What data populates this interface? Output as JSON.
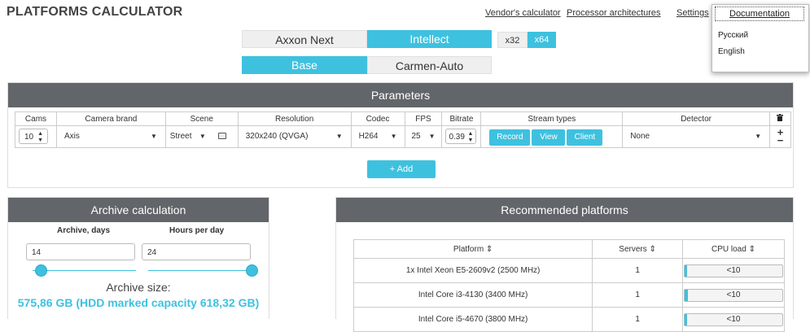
{
  "app": {
    "title": "PLATFORMS CALCULATOR"
  },
  "nav": {
    "vendors": "Vendor's calculator",
    "processors": "Processor architectures",
    "settings": "Settings",
    "documentation": "Documentation"
  },
  "language_menu": {
    "options": [
      "Русский",
      "English"
    ]
  },
  "product_toggle": {
    "options": [
      "Axxon Next",
      "Intellect"
    ],
    "selected": "Intellect"
  },
  "arch_toggle": {
    "options": [
      "x32",
      "x64"
    ],
    "selected": "x64"
  },
  "edition_toggle": {
    "options": [
      "Base",
      "Carmen-Auto"
    ],
    "selected": "Base"
  },
  "parameters": {
    "title": "Parameters",
    "columns": [
      "Cams",
      "Camera brand",
      "Scene",
      "Resolution",
      "Codec",
      "FPS",
      "Bitrate",
      "Stream types",
      "Detector"
    ],
    "delete_icon": "trash-icon",
    "row": {
      "cams": "10",
      "brand": "Axis",
      "scene": "Street",
      "resolution": "320x240 (QVGA)",
      "codec": "H264",
      "fps": "25",
      "bitrate": "0.39",
      "streams": [
        "Record",
        "View",
        "Client"
      ],
      "detector": "None"
    },
    "add_label": "+ Add"
  },
  "archive": {
    "title": "Archive calculation",
    "days_label": "Archive, days",
    "hours_label": "Hours per day",
    "days_value": "14",
    "hours_value": "24",
    "days_slider_fraction": 0.08,
    "hours_slider_fraction": 1.0,
    "size_label": "Archive size:",
    "size_value": "575,86 GB (HDD marked capacity 618,32 GB)"
  },
  "recommended": {
    "title": "Recommended platforms",
    "columns": [
      "Platform ⇕",
      "Servers ⇕",
      "CPU load ⇕"
    ],
    "rows": [
      {
        "platform": "1x Intel Xeon E5-2609v2 (2500 MHz)",
        "servers": "1",
        "cpu": "<10",
        "fill": 0.01
      },
      {
        "platform": "Intel Core i3-4130 (3400 MHz)",
        "servers": "1",
        "cpu": "<10",
        "fill": 0.03
      },
      {
        "platform": "Intel Core i5-4670 (3800 MHz)",
        "servers": "1",
        "cpu": "<10",
        "fill": 0.02
      }
    ]
  },
  "colors": {
    "accent": "#3ec1df",
    "header_bg": "#626569"
  }
}
